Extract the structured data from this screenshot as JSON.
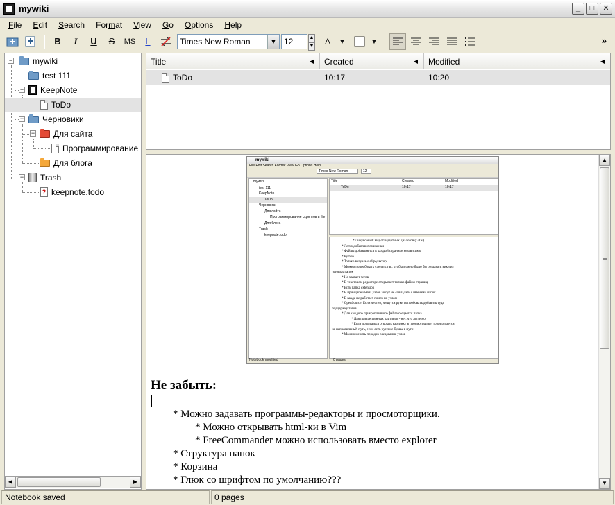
{
  "window": {
    "title": "mywiki"
  },
  "menu": [
    {
      "label": "File",
      "key": "F"
    },
    {
      "label": "Edit",
      "key": "E"
    },
    {
      "label": "Search",
      "key": "S"
    },
    {
      "label": "Format",
      "key": "m"
    },
    {
      "label": "View",
      "key": "V"
    },
    {
      "label": "Go",
      "key": "G"
    },
    {
      "label": "Options",
      "key": "O"
    },
    {
      "label": "Help",
      "key": "H"
    }
  ],
  "toolbar": {
    "bold": "B",
    "italic": "I",
    "underline": "U",
    "strike": "S",
    "monospace": "MS",
    "link": "L",
    "font_family": "Times New Roman",
    "font_size": "12",
    "text_color_label": "A",
    "overflow": "»"
  },
  "tree": [
    {
      "label": "mywiki"
    },
    {
      "label": "test 111"
    },
    {
      "label": "KeepNote"
    },
    {
      "label": "ToDo"
    },
    {
      "label": "Черновики"
    },
    {
      "label": "Для сайта"
    },
    {
      "label": "Программирование скриптов в file"
    },
    {
      "label": "Для блога"
    },
    {
      "label": "Trash"
    },
    {
      "label": "keepnote.todo"
    }
  ],
  "list": {
    "columns": [
      "Title",
      "Created",
      "Modified"
    ],
    "rows": [
      {
        "title": "ToDo",
        "created": "10:17",
        "modified": "10:20"
      }
    ]
  },
  "embedded_screenshot": {
    "title": "mywiki",
    "menu": "File  Edit  Search  Format  View  Go  Options  Help",
    "font": "Times New Roman",
    "size": "12",
    "tree": [
      "mywiki",
      "test 111",
      "KeepNote",
      "ToDo",
      "Черновики",
      "Для сайта",
      "Программирование скриптов в file",
      "Для блога",
      "Trash",
      "keepnote.todo"
    ],
    "columns": [
      "Title",
      "Created",
      "Modified"
    ],
    "row": [
      "ToDo",
      "10:17",
      "10:17"
    ],
    "lines": [
      "* Линуксовый вид стандартных диалогов (GTK)",
      "* Легко добавляются иконки",
      "* Файлы добавляются в каждой странице независимо",
      "* Python",
      "* Только визуальный редактор",
      "* Можно попробовать сделать так, чтобы можно было бы создавать вики из",
      "готовых папок",
      "* Не хватает тегов",
      "* В текстовом редакторе открывает только файлы страниц",
      "* Есть папка extension",
      "* В принципе имена узлов могут не совпадать с именами папок",
      "* В вакде не работает поиск по узлам",
      "* OpenSource. Если честно, чешутся руки попробовать добавить туда",
      "поддержку тегов",
      "* Для каждого прикрепленного файла создается папка",
      "* Для прикрепленных картинок - нет, что логично",
      "* Если попытаться открыть картинку в просмотрщике, то он ругается",
      "на неправильный путь, если есть русские буквы в пути",
      "* Можно менять порядок следования узлов"
    ],
    "status_left": "Notebook modified",
    "status_right": "0 pages"
  },
  "editor": {
    "heading": "Не забыть:",
    "lines": [
      "* Можно задавать программы-редакторы и просмоторщики.",
      "* Можно открывать html-ки в Vim",
      "* FreeCommander можно использовать вместо explorer",
      "* Структура папок",
      "* Корзина",
      "* Глюк со шрифтом по умолчанию???"
    ]
  },
  "status": {
    "left": "Notebook saved",
    "right": "0 pages"
  }
}
